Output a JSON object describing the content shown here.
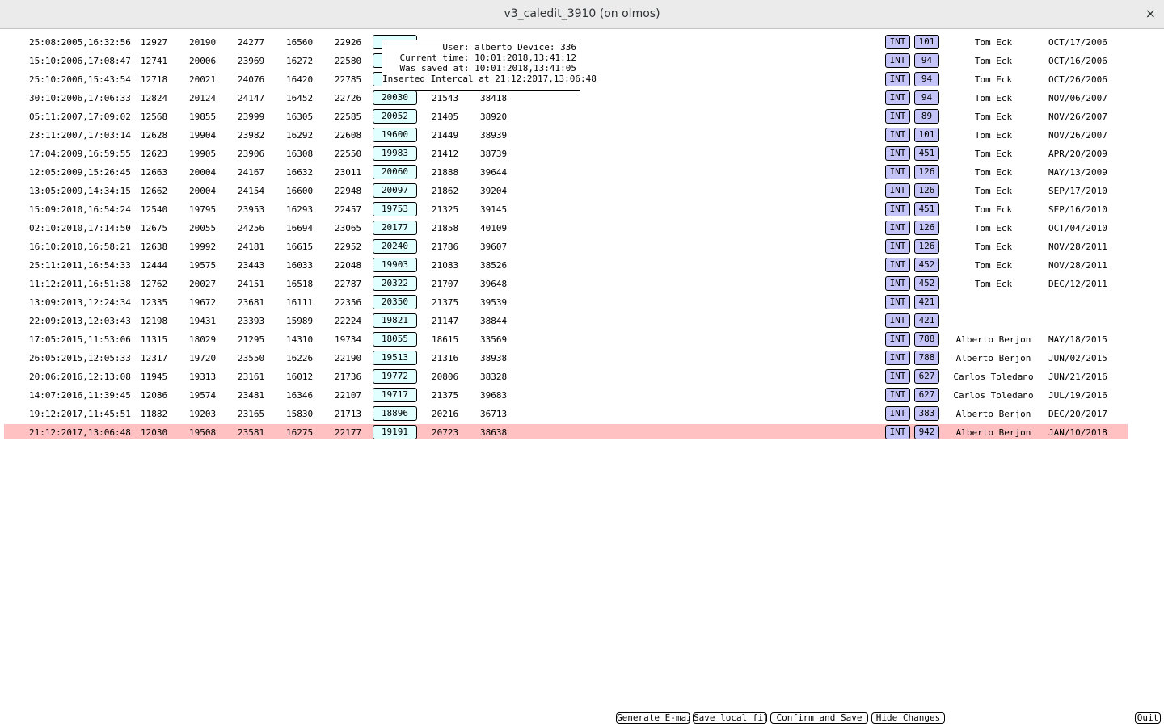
{
  "window": {
    "title": "v3_caledit_3910 (on olmos)",
    "close_glyph": "×"
  },
  "tooltip": {
    "line1": "User: alberto Device: 336",
    "line2": "Current time: 10:01:2018,13:41:12",
    "line3": "Was saved at: 10:01:2018,13:41:05",
    "line4": "Inserted Intercal at 21:12:2017,13:06:48"
  },
  "rows": [
    {
      "ts": "25:08:2005,16:32:56",
      "v1": "12927",
      "v2": "20190",
      "v3": "24277",
      "v4": "16560",
      "v5": "22926",
      "box": "",
      "v7": "",
      "v8": "",
      "tag": "INT",
      "dev": "101",
      "user": "Tom Eck",
      "date": "OCT/17/2006"
    },
    {
      "ts": "15:10:2006,17:08:47",
      "v1": "12741",
      "v2": "20006",
      "v3": "23969",
      "v4": "16272",
      "v5": "22580",
      "box": "",
      "v7": "",
      "v8": "",
      "tag": "INT",
      "dev": "94",
      "user": "Tom Eck",
      "date": "OCT/16/2006"
    },
    {
      "ts": "25:10:2006,15:43:54",
      "v1": "12718",
      "v2": "20021",
      "v3": "24076",
      "v4": "16420",
      "v5": "22785",
      "box": "",
      "v7": "",
      "v8": "",
      "tag": "INT",
      "dev": "94",
      "user": "Tom Eck",
      "date": "OCT/26/2006"
    },
    {
      "ts": "30:10:2006,17:06:33",
      "v1": "12824",
      "v2": "20124",
      "v3": "24147",
      "v4": "16452",
      "v5": "22726",
      "box": "20030",
      "v7": "21543",
      "v8": "38418",
      "tag": "INT",
      "dev": "94",
      "user": "Tom Eck",
      "date": "NOV/06/2007"
    },
    {
      "ts": "05:11:2007,17:09:02",
      "v1": "12568",
      "v2": "19855",
      "v3": "23999",
      "v4": "16305",
      "v5": "22585",
      "box": "20052",
      "v7": "21405",
      "v8": "38920",
      "tag": "INT",
      "dev": "89",
      "user": "Tom Eck",
      "date": "NOV/26/2007"
    },
    {
      "ts": "23:11:2007,17:03:14",
      "v1": "12628",
      "v2": "19904",
      "v3": "23982",
      "v4": "16292",
      "v5": "22608",
      "box": "19600",
      "v7": "21449",
      "v8": "38939",
      "tag": "INT",
      "dev": "101",
      "user": "Tom Eck",
      "date": "NOV/26/2007"
    },
    {
      "ts": "17:04:2009,16:59:55",
      "v1": "12623",
      "v2": "19905",
      "v3": "23906",
      "v4": "16308",
      "v5": "22550",
      "box": "19983",
      "v7": "21412",
      "v8": "38739",
      "tag": "INT",
      "dev": "451",
      "user": "Tom Eck",
      "date": "APR/20/2009"
    },
    {
      "ts": "12:05:2009,15:26:45",
      "v1": "12663",
      "v2": "20004",
      "v3": "24167",
      "v4": "16632",
      "v5": "23011",
      "box": "20060",
      "v7": "21888",
      "v8": "39644",
      "tag": "INT",
      "dev": "126",
      "user": "Tom Eck",
      "date": "MAY/13/2009"
    },
    {
      "ts": "13:05:2009,14:34:15",
      "v1": "12662",
      "v2": "20004",
      "v3": "24154",
      "v4": "16600",
      "v5": "22948",
      "box": "20097",
      "v7": "21862",
      "v8": "39204",
      "tag": "INT",
      "dev": "126",
      "user": "Tom Eck",
      "date": "SEP/17/2010"
    },
    {
      "ts": "15:09:2010,16:54:24",
      "v1": "12540",
      "v2": "19795",
      "v3": "23953",
      "v4": "16293",
      "v5": "22457",
      "box": "19753",
      "v7": "21325",
      "v8": "39145",
      "tag": "INT",
      "dev": "451",
      "user": "Tom Eck",
      "date": "SEP/16/2010"
    },
    {
      "ts": "02:10:2010,17:14:50",
      "v1": "12675",
      "v2": "20055",
      "v3": "24256",
      "v4": "16694",
      "v5": "23065",
      "box": "20177",
      "v7": "21858",
      "v8": "40109",
      "tag": "INT",
      "dev": "126",
      "user": "Tom Eck",
      "date": "OCT/04/2010"
    },
    {
      "ts": "16:10:2010,16:58:21",
      "v1": "12638",
      "v2": "19992",
      "v3": "24181",
      "v4": "16615",
      "v5": "22952",
      "box": "20240",
      "v7": "21786",
      "v8": "39607",
      "tag": "INT",
      "dev": "126",
      "user": "Tom Eck",
      "date": "NOV/28/2011"
    },
    {
      "ts": "25:11:2011,16:54:33",
      "v1": "12444",
      "v2": "19575",
      "v3": "23443",
      "v4": "16033",
      "v5": "22048",
      "box": "19903",
      "v7": "21083",
      "v8": "38526",
      "tag": "INT",
      "dev": "452",
      "user": "Tom Eck",
      "date": "NOV/28/2011"
    },
    {
      "ts": "11:12:2011,16:51:38",
      "v1": "12762",
      "v2": "20027",
      "v3": "24151",
      "v4": "16518",
      "v5": "22787",
      "box": "20322",
      "v7": "21707",
      "v8": "39648",
      "tag": "INT",
      "dev": "452",
      "user": "Tom Eck",
      "date": "DEC/12/2011"
    },
    {
      "ts": "13:09:2013,12:24:34",
      "v1": "12335",
      "v2": "19672",
      "v3": "23681",
      "v4": "16111",
      "v5": "22356",
      "box": "20350",
      "v7": "21375",
      "v8": "39539",
      "tag": "INT",
      "dev": "421",
      "user": "",
      "date": ""
    },
    {
      "ts": "22:09:2013,12:03:43",
      "v1": "12198",
      "v2": "19431",
      "v3": "23393",
      "v4": "15989",
      "v5": "22224",
      "box": "19821",
      "v7": "21147",
      "v8": "38844",
      "tag": "INT",
      "dev": "421",
      "user": "",
      "date": ""
    },
    {
      "ts": "17:05:2015,11:53:06",
      "v1": "11315",
      "v2": "18029",
      "v3": "21295",
      "v4": "14310",
      "v5": "19734",
      "box": "18055",
      "v7": "18615",
      "v8": "33569",
      "tag": "INT",
      "dev": "788",
      "user": "Alberto Berjon",
      "date": "MAY/18/2015"
    },
    {
      "ts": "26:05:2015,12:05:33",
      "v1": "12317",
      "v2": "19720",
      "v3": "23550",
      "v4": "16226",
      "v5": "22190",
      "box": "19513",
      "v7": "21316",
      "v8": "38938",
      "tag": "INT",
      "dev": "788",
      "user": "Alberto Berjon",
      "date": "JUN/02/2015"
    },
    {
      "ts": "20:06:2016,12:13:08",
      "v1": "11945",
      "v2": "19313",
      "v3": "23161",
      "v4": "16012",
      "v5": "21736",
      "box": "19772",
      "v7": "20806",
      "v8": "38328",
      "tag": "INT",
      "dev": "627",
      "user": "Carlos Toledano",
      "date": "JUN/21/2016"
    },
    {
      "ts": "14:07:2016,11:39:45",
      "v1": "12086",
      "v2": "19574",
      "v3": "23481",
      "v4": "16346",
      "v5": "22107",
      "box": "19717",
      "v7": "21375",
      "v8": "39683",
      "tag": "INT",
      "dev": "627",
      "user": "Carlos Toledano",
      "date": "JUL/19/2016"
    },
    {
      "ts": "19:12:2017,11:45:51",
      "v1": "11882",
      "v2": "19203",
      "v3": "23165",
      "v4": "15830",
      "v5": "21713",
      "box": "18896",
      "v7": "20216",
      "v8": "36713",
      "tag": "INT",
      "dev": "383",
      "user": "Alberto Berjon",
      "date": "DEC/20/2017"
    },
    {
      "ts": "21:12:2017,13:06:48",
      "v1": "12030",
      "v2": "19508",
      "v3": "23581",
      "v4": "16275",
      "v5": "22177",
      "box": "19191",
      "v7": "20723",
      "v8": "38638",
      "tag": "INT",
      "dev": "942",
      "user": "Alberto Berjon",
      "date": "JAN/10/2018",
      "highlight": true
    }
  ],
  "buttons": {
    "email": "Generate E-mail",
    "save_local": "Save local file",
    "confirm": "Confirm and Save",
    "hide": "Hide Changes",
    "quit": "Quit"
  },
  "colors": {
    "highlight_row": "#ffc1c1",
    "edit_box": "#e0ffff",
    "tag_button": "#c4c4f8"
  }
}
